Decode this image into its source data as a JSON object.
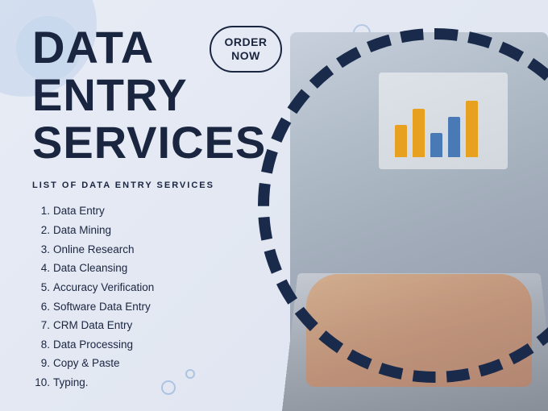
{
  "page": {
    "background_color": "#e8ecf5"
  },
  "header": {
    "title_line1": "DATA ENTRY",
    "title_line2": "SERVICES"
  },
  "order_button": {
    "label": "ORDER\nNOW"
  },
  "section": {
    "list_heading": "LIST OF DATA ENTRY SERVICES"
  },
  "services": [
    {
      "number": "1.",
      "label": "Data Entry"
    },
    {
      "number": "2.",
      "label": "Data Mining"
    },
    {
      "number": "3.",
      "label": "Online Research"
    },
    {
      "number": "4.",
      "label": "Data Cleansing"
    },
    {
      "number": "5.",
      "label": "Accuracy Verification"
    },
    {
      "number": "6.",
      "label": "Software Data Entry"
    },
    {
      "number": "7.",
      "label": "CRM Data Entry"
    },
    {
      "number": "8.",
      "label": "Data Processing"
    },
    {
      "number": "9.",
      "label": "Copy & Paste"
    },
    {
      "number": "10.",
      "label": "Typing."
    }
  ]
}
